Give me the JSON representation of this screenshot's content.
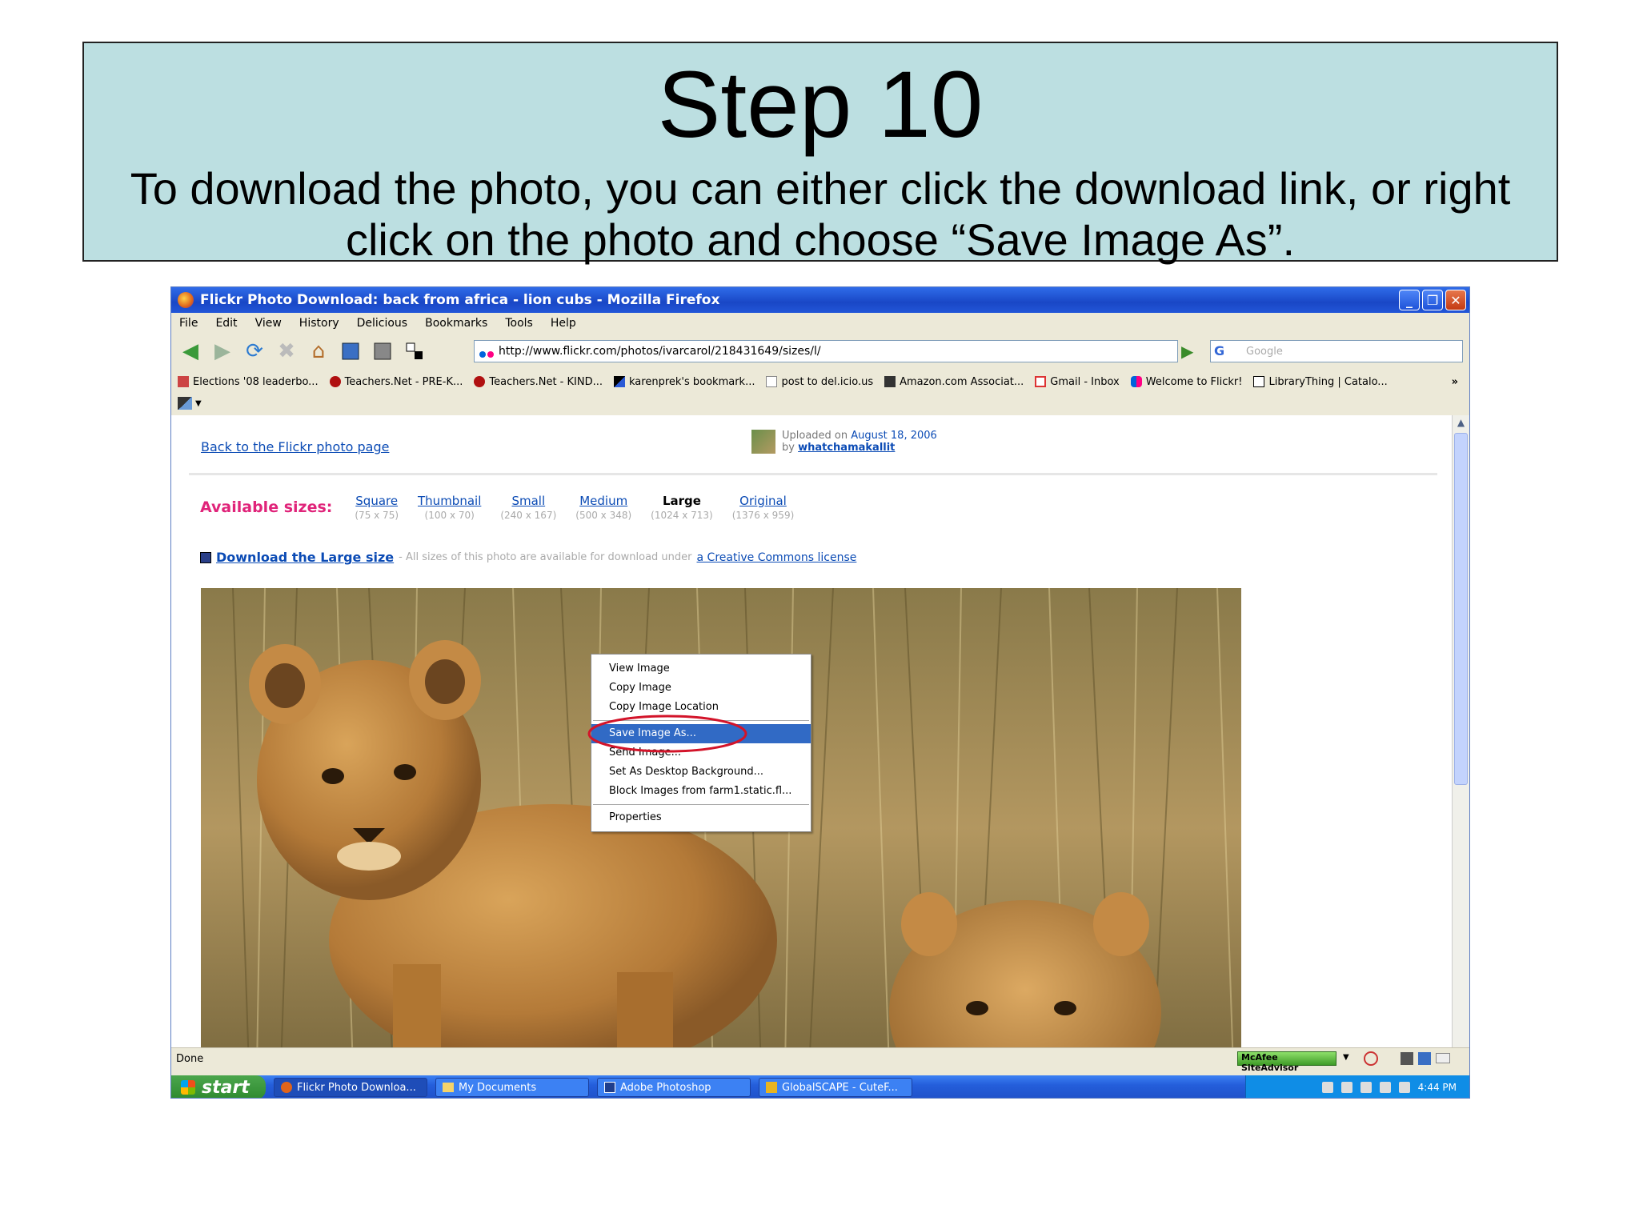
{
  "slide": {
    "title": "Step 10",
    "instruction": "To download the photo, you can either click the download link, or right click on the photo and choose “Save Image As”."
  },
  "window": {
    "title": "Flickr Photo Download: back from africa - lion cubs - Mozilla Firefox",
    "min_label": "_",
    "max_label": "❐",
    "close_label": "✕"
  },
  "menu": {
    "items": [
      "File",
      "Edit",
      "View",
      "History",
      "Delicious",
      "Bookmarks",
      "Tools",
      "Help"
    ]
  },
  "address": {
    "url": "http://www.flickr.com/photos/ivarcarol/218431649/sizes/l/",
    "search_placeholder": "Google",
    "search_logo": "G"
  },
  "bookmarks": {
    "items": [
      "Elections '08 leaderbo...",
      "Teachers.Net - PRE-K...",
      "Teachers.Net - KIND...",
      "karenprek's bookmark...",
      "post to del.icio.us",
      "Amazon.com Associat...",
      "Gmail - Inbox",
      "Welcome to Flickr!",
      "LibraryThing | Catalo..."
    ],
    "overflow": "»"
  },
  "page": {
    "back_link": "Back to the Flickr photo page",
    "uploaded_prefix": "Uploaded on",
    "uploaded_date": "August 18, 2006",
    "by_prefix": "by",
    "uploader": "whatchamakallit",
    "available_label": "Available sizes:",
    "sizes": [
      {
        "name": "Square",
        "dim": "(75 x 75)"
      },
      {
        "name": "Thumbnail",
        "dim": "(100 x 70)"
      },
      {
        "name": "Small",
        "dim": "(240 x 167)"
      },
      {
        "name": "Medium",
        "dim": "(500 x 348)"
      },
      {
        "name": "Large",
        "dim": "(1024 x 713)"
      },
      {
        "name": "Original",
        "dim": "(1376 x 959)"
      }
    ],
    "download_link": "Download the Large size",
    "download_note": "- All sizes of this photo are available for download under",
    "cc_link": "a Creative Commons license"
  },
  "context_menu": {
    "items": [
      "View Image",
      "Copy Image",
      "Copy Image Location",
      "Save Image As...",
      "Send Image...",
      "Set As Desktop Background...",
      "Block Images from farm1.static.fl...",
      "Properties"
    ],
    "highlighted": "Save Image As..."
  },
  "status": {
    "text": "Done",
    "mcafee": "McAfee SiteAdvisor"
  },
  "taskbar": {
    "start": "start",
    "tasks": [
      "Flickr Photo Downloa...",
      "My Documents",
      "Adobe Photoshop",
      "GlobalSCAPE - CuteF..."
    ],
    "clock": "4:44 PM"
  },
  "colors": {
    "title_box_bg": "#bcdfe1",
    "link_blue": "#0b4bb5",
    "flickr_pink": "#e0247a",
    "xp_blue": "#245edb",
    "highlight": "#316ac5",
    "annotation_red": "#d3142a"
  }
}
